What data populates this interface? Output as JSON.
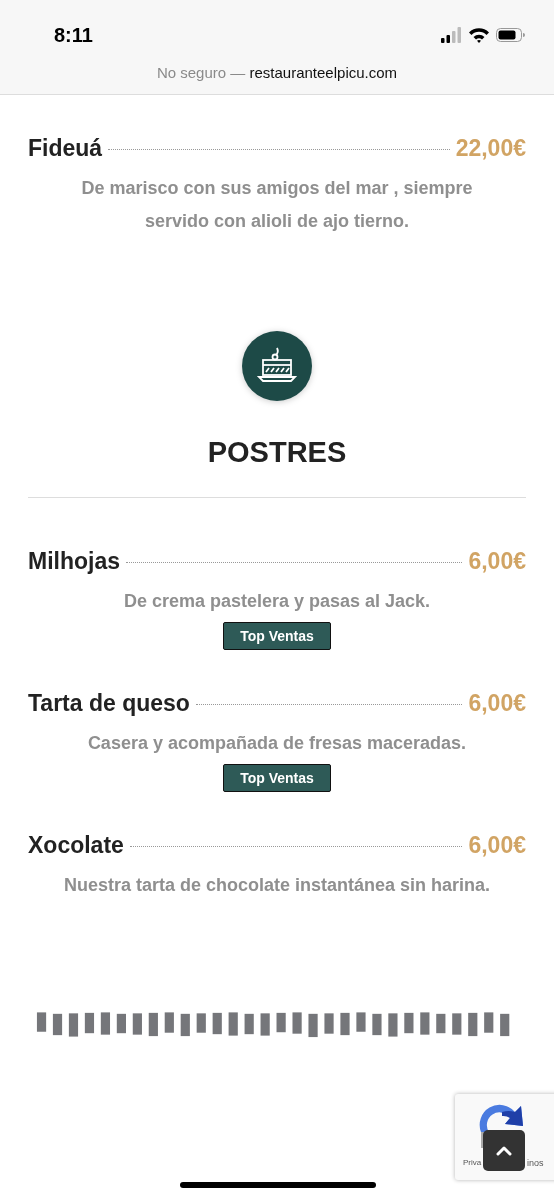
{
  "status_bar": {
    "time": "8:11"
  },
  "address_bar": {
    "security": "No seguro —",
    "domain": "restauranteelpicu.com"
  },
  "top_items": [
    {
      "name": "Fideuá",
      "price": "22,00€",
      "description": "De marisco con sus amigos del mar , siempre servido con alioli de ajo tierno."
    }
  ],
  "section": {
    "title": "POSTRES"
  },
  "items": [
    {
      "name": "Milhojas",
      "price": "6,00€",
      "description": "De crema pastelera y pasas al Jack.",
      "badge": "Top Ventas"
    },
    {
      "name": "Tarta de queso",
      "price": "6,00€",
      "description": "Casera y acompañada de fresas maceradas.",
      "badge": "Top Ventas"
    },
    {
      "name": "Xocolate",
      "price": "6,00€",
      "description": "Nuestra tarta de chocolate instantánea sin harina."
    }
  ],
  "recaptcha": {
    "left_text": "Priva",
    "right_text": "inos"
  }
}
